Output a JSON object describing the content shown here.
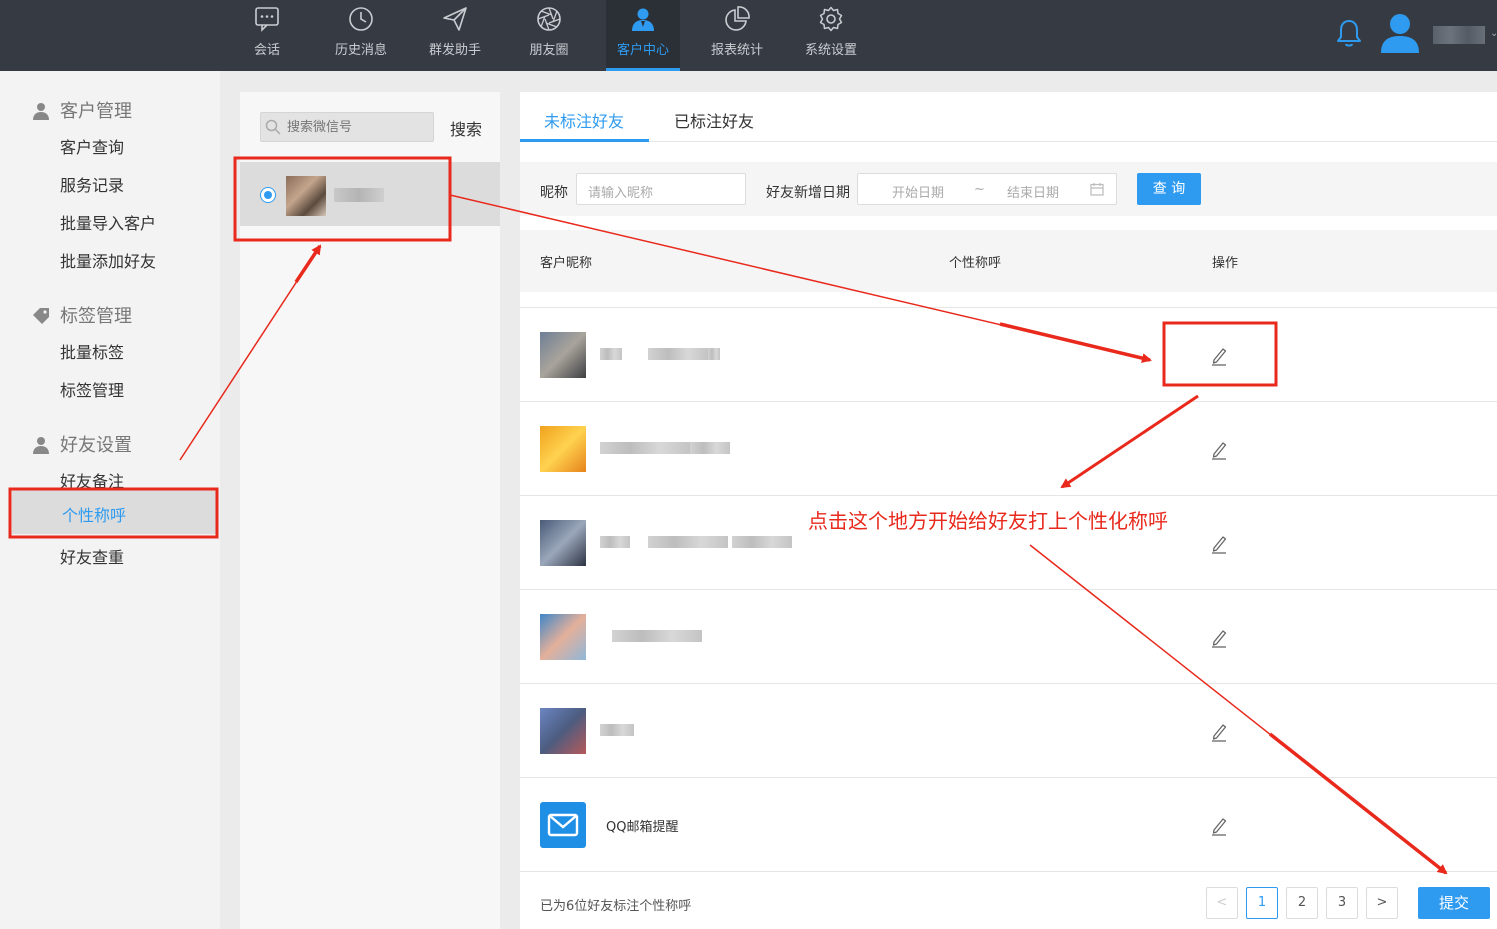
{
  "nav": {
    "items": [
      {
        "label": "会话",
        "icon": "chat-icon"
      },
      {
        "label": "历史消息",
        "icon": "clock-icon"
      },
      {
        "label": "群发助手",
        "icon": "paper-plane-icon"
      },
      {
        "label": "朋友圈",
        "icon": "aperture-icon"
      },
      {
        "label": "客户中心",
        "icon": "person-icon",
        "active": true
      },
      {
        "label": "报表统计",
        "icon": "pie-chart-icon"
      },
      {
        "label": "系统设置",
        "icon": "gear-icon"
      }
    ]
  },
  "sidebar": {
    "groups": [
      {
        "title": "客户管理",
        "icon": "person-icon",
        "items": [
          "客户查询",
          "服务记录",
          "批量导入客户",
          "批量添加好友"
        ]
      },
      {
        "title": "标签管理",
        "icon": "tag-icon",
        "items": [
          "批量标签",
          "标签管理"
        ]
      },
      {
        "title": "好友设置",
        "icon": "person-icon",
        "items": [
          "好友备注",
          "个性称呼",
          "好友查重"
        ]
      }
    ],
    "active_item": "个性称呼"
  },
  "middle": {
    "search_placeholder": "搜索微信号",
    "search_button": "搜索"
  },
  "main": {
    "tabs": [
      "未标注好友",
      "已标注好友"
    ],
    "active_tab": "未标注好友",
    "filter": {
      "nickname_label": "昵称",
      "nickname_placeholder": "请输入昵称",
      "date_label": "好友新增日期",
      "start_placeholder": "开始日期",
      "separator": "~",
      "end_placeholder": "结束日期",
      "query_button": "查 询"
    },
    "table": {
      "headers": [
        "客户昵称",
        "个性称呼",
        "操作"
      ],
      "rows": [
        {
          "name": "",
          "avatar_colors": [
            "#6f7f96",
            "#a9a49b",
            "#3e3f43"
          ]
        },
        {
          "name": "",
          "avatar_colors": [
            "#f0a21d",
            "#ffd24f",
            "#e6831a"
          ]
        },
        {
          "name": "",
          "avatar_colors": [
            "#4a5a78",
            "#9aa7ba",
            "#2d3444"
          ]
        },
        {
          "name": "",
          "avatar_colors": [
            "#3f86c8",
            "#e4b09a",
            "#8fb7d9"
          ]
        },
        {
          "name": "",
          "avatar_colors": [
            "#6a86c2",
            "#4d5c80",
            "#b55a5a"
          ]
        },
        {
          "name": "QQ邮箱提醒",
          "avatar_colors": [
            "#1f8fe6",
            "#55b7ff",
            "#1f8fe6"
          ]
        }
      ]
    },
    "footer_text": "已为6位好友标注个性称呼",
    "pagination": {
      "prev": "<",
      "pages": [
        "1",
        "2",
        "3"
      ],
      "current": "1",
      "next": ">"
    },
    "submit_button": "提交"
  },
  "annotation": {
    "text": "点击这个地方开始给好友打上个性化称呼",
    "color": "#e8291c"
  },
  "colors": {
    "accent": "#2f9bf0",
    "topbar": "#363b43"
  }
}
